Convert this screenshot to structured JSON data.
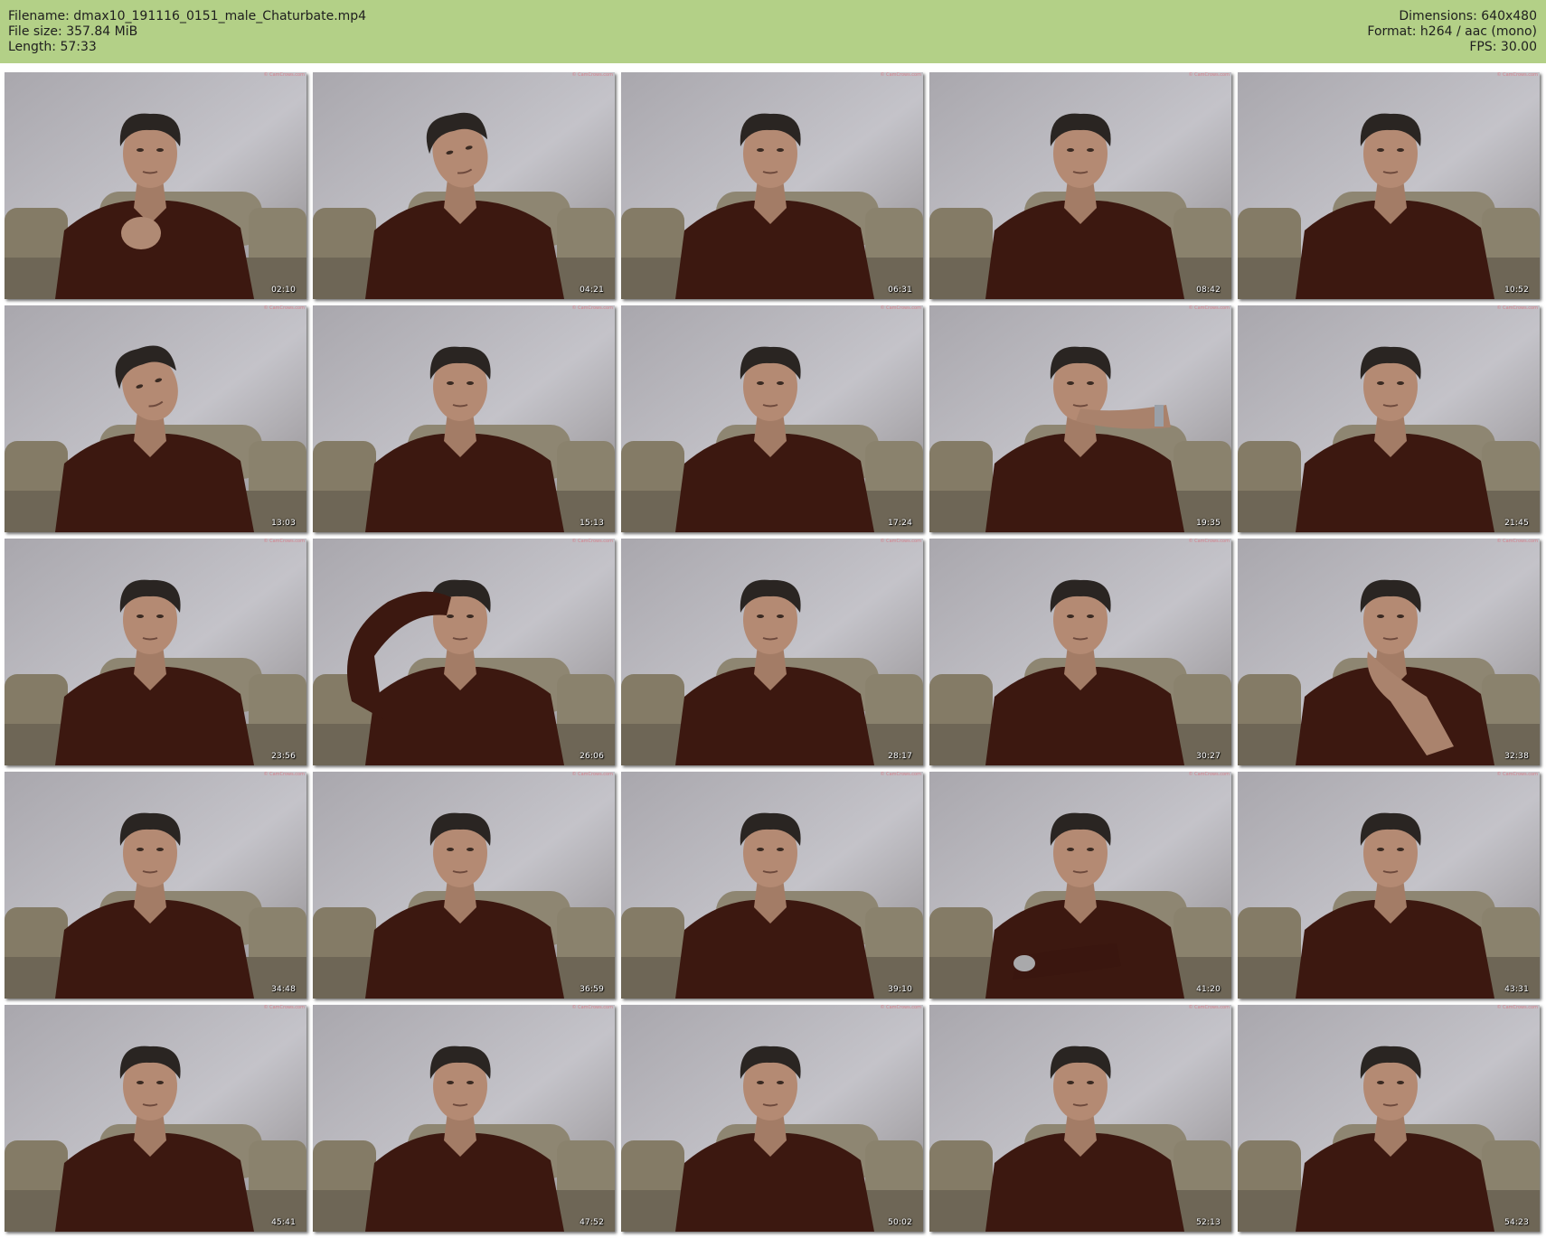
{
  "header": {
    "filename": "Filename: dmax10_191116_0151_male_Chaturbate.mp4",
    "filesize": "File size: 357.84 MiB",
    "length": "Length: 57:33",
    "dimensions": "Dimensions: 640x480",
    "format": "Format: h264 / aac (mono)",
    "fps": "FPS: 30.00"
  },
  "colors": {
    "header_bg": "#b3d087",
    "wall": "#b9b7bd",
    "sofa": "#847b66",
    "shirt": "#3c1810",
    "skin": "#b48a73",
    "hair": "#2a2522"
  },
  "watermark": "© CamCrows.com",
  "thumbnails": [
    {
      "time": "02:10",
      "pose": "hand-chest"
    },
    {
      "time": "04:21",
      "pose": "head-tilt"
    },
    {
      "time": "06:31",
      "pose": "neutral"
    },
    {
      "time": "08:42",
      "pose": "neutral"
    },
    {
      "time": "10:52",
      "pose": "neutral"
    },
    {
      "time": "13:03",
      "pose": "head-tilt-left"
    },
    {
      "time": "15:13",
      "pose": "neutral"
    },
    {
      "time": "17:24",
      "pose": "neutral"
    },
    {
      "time": "19:35",
      "pose": "hand-mouth"
    },
    {
      "time": "21:45",
      "pose": "neutral"
    },
    {
      "time": "23:56",
      "pose": "neutral"
    },
    {
      "time": "26:06",
      "pose": "arm-up"
    },
    {
      "time": "28:17",
      "pose": "neutral"
    },
    {
      "time": "30:27",
      "pose": "neutral"
    },
    {
      "time": "32:38",
      "pose": "hand-chin"
    },
    {
      "time": "34:48",
      "pose": "neutral"
    },
    {
      "time": "36:59",
      "pose": "neutral"
    },
    {
      "time": "39:10",
      "pose": "neutral"
    },
    {
      "time": "41:20",
      "pose": "arm-cross"
    },
    {
      "time": "43:31",
      "pose": "neutral"
    },
    {
      "time": "45:41",
      "pose": "neutral"
    },
    {
      "time": "47:52",
      "pose": "neutral"
    },
    {
      "time": "50:02",
      "pose": "neutral"
    },
    {
      "time": "52:13",
      "pose": "neutral"
    },
    {
      "time": "54:23",
      "pose": "neutral"
    }
  ]
}
